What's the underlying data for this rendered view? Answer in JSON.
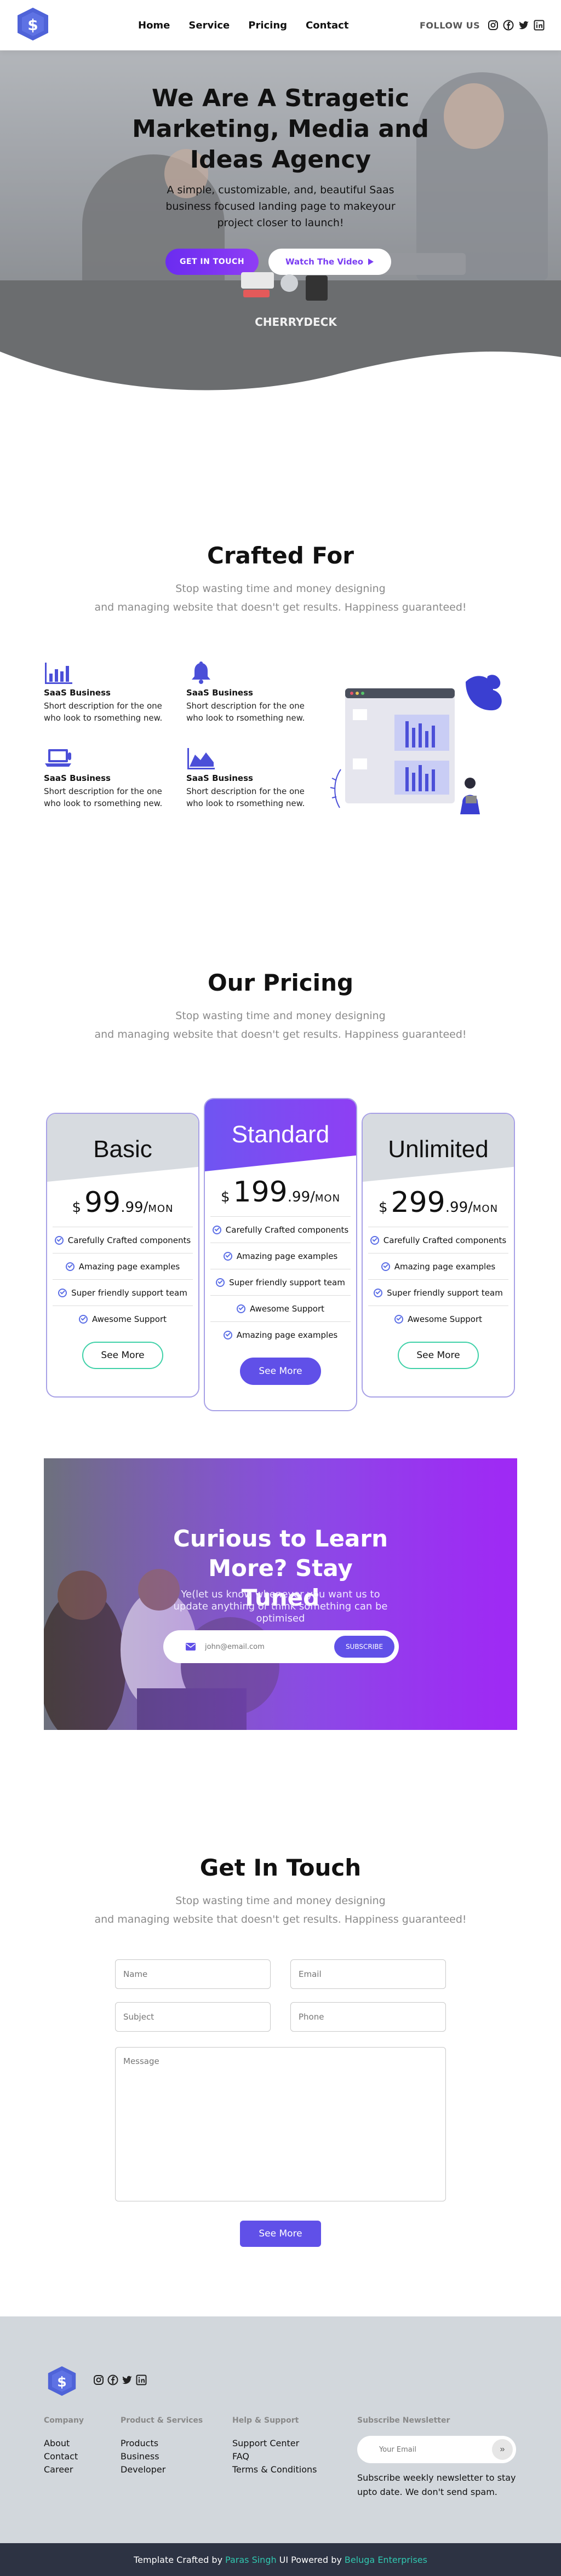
{
  "header": {
    "nav": [
      "Home",
      "Service",
      "Pricing",
      "Contact"
    ],
    "follow_label": "FOLLOW US",
    "social_icons": [
      "instagram-icon",
      "facebook-icon",
      "twitter-icon",
      "linkedin-icon"
    ]
  },
  "hero": {
    "title": "We Are A Stragetic Marketing, Media and Ideas Agency",
    "subtitle": "A simple, customizable, and, beautiful Saas business focused landing page to makeyour project closer to launch!",
    "cta_primary": "GET IN TOUCH",
    "cta_video": "Watch The Video",
    "sticker_text": "CHERRYDECK"
  },
  "crafted": {
    "title": "Crafted For",
    "subtitle_line1": "Stop wasting time and money designing",
    "subtitle_line2": "and managing website that doesn't get results. Happiness guaranteed!",
    "features": [
      {
        "icon": "bar-chart-icon",
        "title": "SaaS Business",
        "desc": "Short description for the one who look to rsomething new."
      },
      {
        "icon": "bell-icon",
        "title": "SaaS Business",
        "desc": "Short description for the one who look to rsomething new."
      },
      {
        "icon": "laptop-icon",
        "title": "SaaS Business",
        "desc": "Short description for the one who look to rsomething new."
      },
      {
        "icon": "area-chart-icon",
        "title": "SaaS Business",
        "desc": "Short description for the one who look to rsomething new."
      }
    ]
  },
  "pricing": {
    "title": "Our Pricing",
    "subtitle_line1": "Stop wasting time and money designing",
    "subtitle_line2": "and managing website that doesn't get results. Happiness guaranteed!",
    "plans": [
      {
        "name": "Basic",
        "currency": "$",
        "amount": "99",
        "cents": ".99/",
        "per": "MON",
        "features": [
          "Carefully Crafted components",
          "Amazing page examples",
          "Super friendly support team",
          "Awesome Support"
        ],
        "button": "See More"
      },
      {
        "name": "Standard",
        "currency": "$",
        "amount": "199",
        "cents": ".99/",
        "per": "MON",
        "features": [
          "Carefully Crafted components",
          "Amazing page examples",
          "Super friendly support team",
          "Awesome Support",
          "Amazing page examples"
        ],
        "button": "See More"
      },
      {
        "name": "Unlimited",
        "currency": "$",
        "amount": "299",
        "cents": ".99/",
        "per": "MON",
        "features": [
          "Carefully Crafted components",
          "Amazing page examples",
          "Super friendly support team",
          "Awesome Support"
        ],
        "button": "See More"
      }
    ]
  },
  "newsletter": {
    "title": "Curious to Learn More? Stay Tuned",
    "subtitle": "Ye(let us know whenever you want us to update anything or think something can be optimised",
    "placeholder": "john@email.com",
    "button": "SUBSCRIBE"
  },
  "contact": {
    "title": "Get In Touch",
    "subtitle_line1": "Stop wasting time and money designing",
    "subtitle_line2": "and managing website that doesn't get results. Happiness guaranteed!",
    "name_placeholder": "Name",
    "email_placeholder": "Email",
    "subject_placeholder": "Subject",
    "phone_placeholder": "Phone",
    "message_placeholder": "Message",
    "button": "See More"
  },
  "footer": {
    "columns": [
      {
        "heading": "Company",
        "links": [
          "About",
          "Contact",
          "Career"
        ]
      },
      {
        "heading": "Product & Services",
        "links": [
          "Products",
          "Business",
          "Developer"
        ]
      },
      {
        "heading": "Help & Support",
        "links": [
          "Support Center",
          "FAQ",
          "Terms & Conditions"
        ]
      }
    ],
    "newsletter_heading": "Subscribe Newsletter",
    "newsletter_placeholder": "Your Email",
    "newsletter_desc": "Subscribe weekly newsletter to stay upto date. We don't send spam.",
    "credit_prefix": "Template Crafted by",
    "credit_author": "Paras Singh",
    "credit_middle": "UI Powered by",
    "credit_company": "Beluga Enterprises"
  },
  "colors": {
    "accent": "#6050e8",
    "purple": "#8f3df5",
    "teal": "#30c8b0",
    "icon_blue": "#4b4fd8"
  }
}
